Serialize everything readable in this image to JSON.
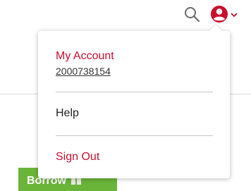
{
  "colors": {
    "accent": "#c8102e",
    "borrow_green": "#6bb43a",
    "text_dark": "#222222"
  },
  "header": {
    "search_icon": "search-icon",
    "account_icon": "user-circle-icon",
    "account_chevron_icon": "chevron-down-icon"
  },
  "dropdown": {
    "account_label": "My Account",
    "account_number": "2000738154",
    "help_label": "Help",
    "signout_label": "Sign Out"
  },
  "background": {
    "borrow_label": "Borrow",
    "borrow_icon": "book-icon"
  }
}
